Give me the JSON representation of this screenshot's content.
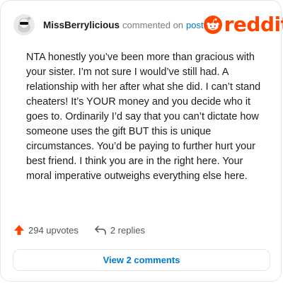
{
  "comment": {
    "username": "MissBerrylicious",
    "action_text": "commented on",
    "post_link": "post",
    "body": "NTA honestly you’ve been more than gracious with your sister. I’m not sure I would’ve still had. A relationship with her after what she did. I can’t stand cheaters! It’s YOUR money and you decide who it goes to. Ordinarily I’d say that you can’t dictate how someone uses the gift BUT this is unique circumstances. You’d be paying to further hurt your best friend. I think you are in the right here. Your moral imperative outweighs everything else here.",
    "upvotes": "294 upvotes",
    "replies": "2 replies",
    "view_comments": "View 2 comments"
  },
  "brand": {
    "logo_text": "reddit",
    "accent": "#ff4500",
    "link_color": "#0079d3"
  },
  "icons": [
    "avatar",
    "reddit-alien-icon",
    "upvote-arrow-icon",
    "reply-arrow-icon"
  ]
}
